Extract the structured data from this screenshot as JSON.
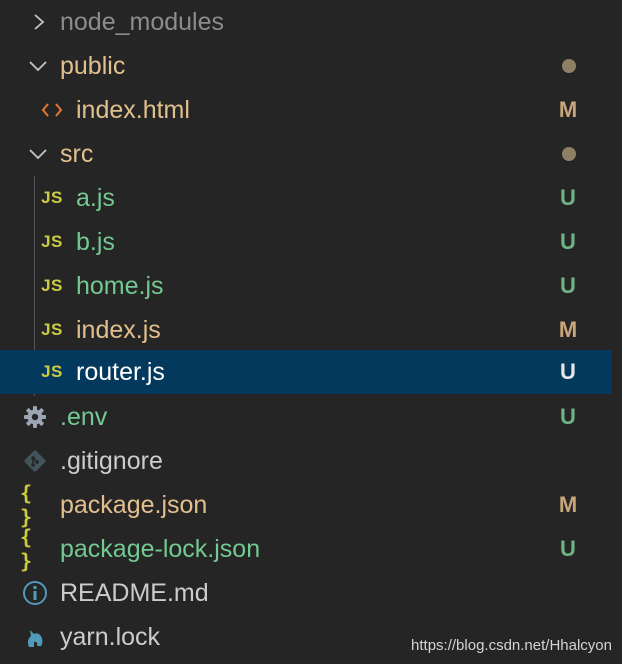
{
  "colors": {
    "background": "#252526",
    "selected_background": "#04395e",
    "ignored_text": "#8c8c8c",
    "modified_text": "#e2c08d",
    "untracked_text": "#73c991",
    "modified_badge": "#c9a67a",
    "untracked_badge": "#6fb284",
    "folder_dot": "#8d8064",
    "normal_text": "#cccccc"
  },
  "explorer": {
    "items": [
      {
        "label": "node_modules",
        "icon": "chevron-right-icon",
        "badge": "",
        "state": "ignored"
      },
      {
        "label": "public",
        "icon": "chevron-down-icon",
        "badge": "",
        "state": "modified",
        "dot": true
      },
      {
        "label": "index.html",
        "icon": "html-file-icon",
        "badge": "M",
        "state": "modified"
      },
      {
        "label": "src",
        "icon": "chevron-down-icon",
        "badge": "",
        "state": "modified",
        "dot": true
      },
      {
        "label": "a.js",
        "icon": "js-file-icon",
        "icon_text": "JS",
        "badge": "U",
        "state": "untracked"
      },
      {
        "label": "b.js",
        "icon": "js-file-icon",
        "icon_text": "JS",
        "badge": "U",
        "state": "untracked"
      },
      {
        "label": "home.js",
        "icon": "js-file-icon",
        "icon_text": "JS",
        "badge": "U",
        "state": "untracked"
      },
      {
        "label": "index.js",
        "icon": "js-file-icon",
        "icon_text": "JS",
        "badge": "M",
        "state": "modified"
      },
      {
        "label": "router.js",
        "icon": "js-file-icon",
        "icon_text": "JS",
        "badge": "U",
        "state": "untracked",
        "selected": true
      },
      {
        "label": ".env",
        "icon": "gear-icon",
        "badge": "U",
        "state": "untracked"
      },
      {
        "label": ".gitignore",
        "icon": "git-icon",
        "badge": "",
        "state": "normal"
      },
      {
        "label": "package.json",
        "icon": "json-braces-icon",
        "icon_text": "{ }",
        "badge": "M",
        "state": "modified"
      },
      {
        "label": "package-lock.json",
        "icon": "json-braces-icon",
        "icon_text": "{ }",
        "badge": "U",
        "state": "untracked"
      },
      {
        "label": "README.md",
        "icon": "info-icon",
        "badge": "",
        "state": "normal"
      },
      {
        "label": "yarn.lock",
        "icon": "yarn-cat-icon",
        "badge": "",
        "state": "normal"
      }
    ]
  },
  "watermark": "https://blog.csdn.net/Hhalcyon"
}
